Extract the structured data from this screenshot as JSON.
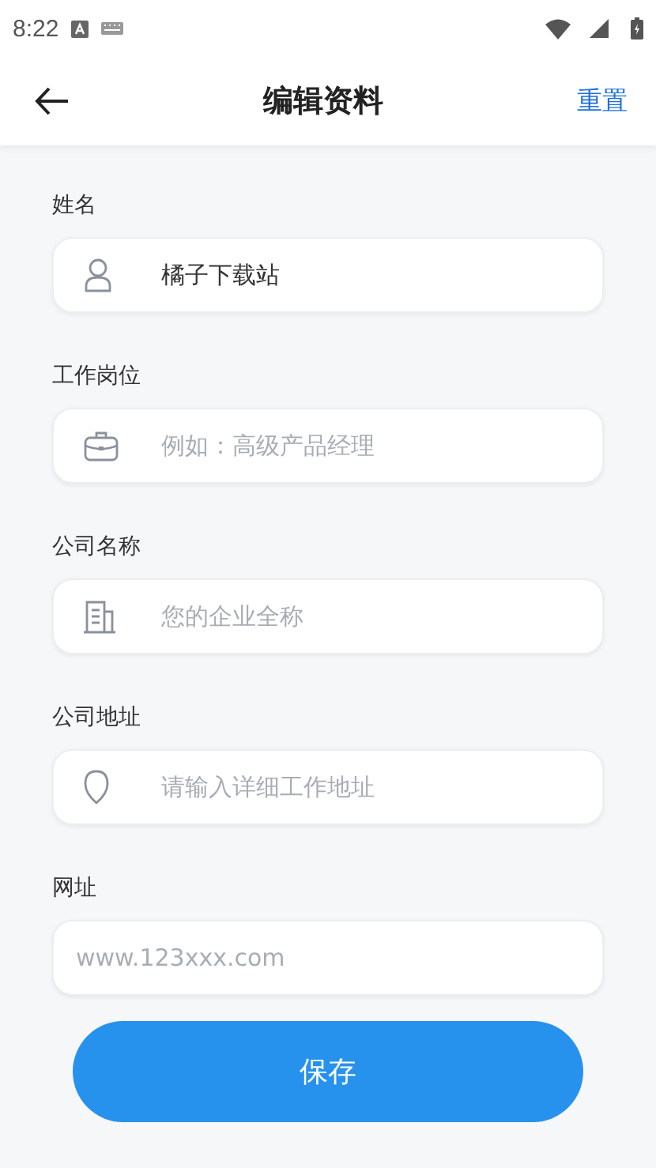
{
  "status_bar": {
    "time": "8:22"
  },
  "header": {
    "title": "编辑资料",
    "action": "重置"
  },
  "fields": [
    {
      "kind": "icon",
      "label": "姓名",
      "value": "橘子下载站"
    },
    {
      "kind": "icon",
      "label": "工作岗位",
      "placeholder": "例如：高级产品经理"
    },
    {
      "kind": "icon",
      "label": "公司名称",
      "placeholder": "您的企业全称"
    },
    {
      "kind": "icon",
      "label": "公司地址",
      "placeholder": "请输入详细工作地址"
    },
    {
      "kind": "plain",
      "label": "网址",
      "placeholder": "www.123xxx.com"
    }
  ],
  "save_button": "保存"
}
